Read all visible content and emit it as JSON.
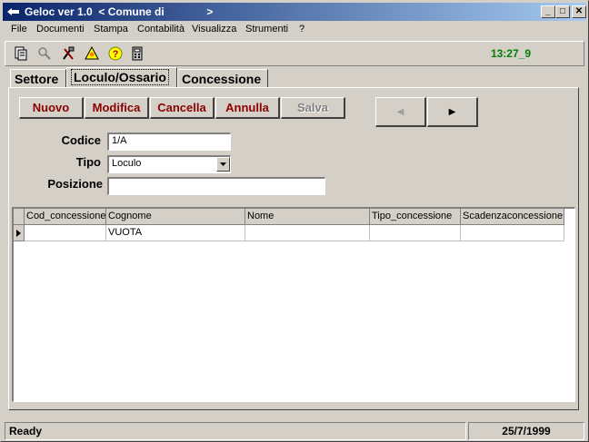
{
  "window": {
    "title": "Geloc ver 1.0  < Comune di              >",
    "minimize_label": "_",
    "maximize_label": "□",
    "close_label": "✕"
  },
  "menu": [
    {
      "label": "File"
    },
    {
      "label": "Documenti"
    },
    {
      "label": "Stampa"
    },
    {
      "label": "Contabilità"
    },
    {
      "label": "Visualizza"
    },
    {
      "label": "Strumenti"
    },
    {
      "label": "?"
    }
  ],
  "toolbar": {
    "icons": [
      "document-icon",
      "search-key-icon",
      "tools-icon",
      "alert-icon",
      "help-icon",
      "calculator-icon"
    ],
    "clock": "13:27_9"
  },
  "tabs": [
    {
      "label": "Settore",
      "active": false
    },
    {
      "label": "Loculo/Ossario",
      "active": true
    },
    {
      "label": "Concessione",
      "active": false
    }
  ],
  "actions": {
    "nuovo": "Nuovo",
    "modifica": "Modifica",
    "cancella": "Cancella",
    "annulla": "Annulla",
    "salva": "Salva"
  },
  "nav": {
    "prev_label": "◀",
    "next_label": "▶"
  },
  "form": {
    "codice_label": "Codice",
    "codice_value": "1/A",
    "tipo_label": "Tipo",
    "tipo_value": "Loculo",
    "posizione_label": "Posizione",
    "posizione_value": ""
  },
  "grid": {
    "columns": [
      "Cod_concessione",
      "Cognome",
      "Nome",
      "Tipo_concessione",
      "Scadenzaconcessione"
    ],
    "rows": [
      [
        "",
        "VUOTA",
        "",
        "",
        ""
      ]
    ]
  },
  "status": {
    "left": "Ready",
    "right": "25/7/1999"
  }
}
